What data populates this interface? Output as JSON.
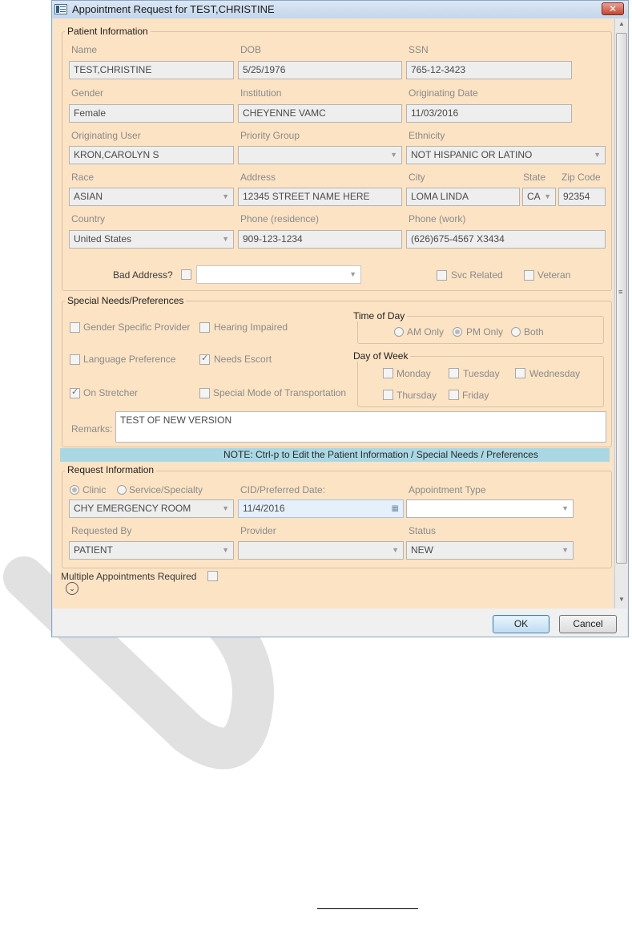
{
  "window": {
    "title": "Appointment Request for TEST,CHRISTINE",
    "close_glyph": "✕"
  },
  "patient": {
    "section_title": "Patient Information",
    "name_label": "Name",
    "name": "TEST,CHRISTINE",
    "dob_label": "DOB",
    "dob": "5/25/1976",
    "ssn_label": "SSN",
    "ssn": "765-12-3423",
    "gender_label": "Gender",
    "gender": "Female",
    "institution_label": "Institution",
    "institution": "CHEYENNE VAMC",
    "orig_date_label": "Originating Date",
    "orig_date": "11/03/2016",
    "orig_user_label": "Originating User",
    "orig_user": "KRON,CAROLYN S",
    "priority_label": "Priority Group",
    "priority": "",
    "ethnicity_label": "Ethnicity",
    "ethnicity": "NOT HISPANIC OR LATINO",
    "race_label": "Race",
    "race": "ASIAN",
    "address_label": "Address",
    "address": "12345 STREET NAME HERE",
    "city_label": "City",
    "city": "LOMA LINDA",
    "state_label": "State",
    "state": "CA",
    "zip_label": "Zip Code",
    "zip": "92354",
    "country_label": "Country",
    "country": "United States",
    "phone_res_label": "Phone (residence)",
    "phone_res": "909-123-1234",
    "phone_work_label": "Phone (work)",
    "phone_work": "(626)675-4567 X3434",
    "bad_address_label": "Bad Address?",
    "bad_address_value": "",
    "svc_related_label": "Svc Related",
    "veteran_label": "Veteran"
  },
  "special_needs": {
    "section_title": "Special Needs/Preferences",
    "gender_provider": "Gender Specific Provider",
    "hearing_impaired": "Hearing Impaired",
    "language_pref": "Language Preference",
    "needs_escort": "Needs Escort",
    "on_stretcher": "On Stretcher",
    "special_transport": "Special Mode of Transportation",
    "time_of_day_title": "Time of Day",
    "am_only": "AM Only",
    "pm_only": "PM Only",
    "both": "Both",
    "day_of_week_title": "Day of Week",
    "monday": "Monday",
    "tuesday": "Tuesday",
    "wednesday": "Wednesday",
    "thursday": "Thursday",
    "friday": "Friday",
    "remarks_label": "Remarks:",
    "remarks": "TEST OF NEW VERSION"
  },
  "note": "NOTE:  Ctrl-p to Edit the Patient Information / Special Needs / Preferences",
  "request": {
    "section_title": "Request Information",
    "clinic": "Clinic",
    "service_specialty": "Service/Specialty",
    "cid_label": "CID/Preferred Date:",
    "appt_type_label": "Appointment Type",
    "clinic_value": "CHY EMERGENCY ROOM",
    "cid_value": "11/4/2016",
    "appt_type_value": "",
    "requested_by_label": "Requested By",
    "provider_label": "Provider",
    "status_label": "Status",
    "requested_by_value": "PATIENT",
    "provider_value": "",
    "status_value": "NEW"
  },
  "multiple_label": "Multiple Appointments Required",
  "buttons": {
    "ok": "OK",
    "cancel": "Cancel"
  },
  "colors": {
    "panel_bg": "#fbe3c4",
    "note_bar": "#a9d8e4",
    "title_bar": "#c3d6ec"
  }
}
